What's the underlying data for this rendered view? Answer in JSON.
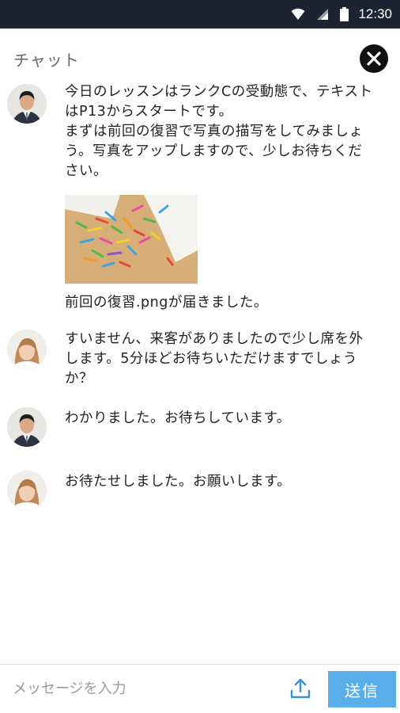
{
  "status_bar": {
    "time": "12:30",
    "icons": [
      "wifi-icon",
      "signal-icon",
      "battery-icon"
    ]
  },
  "header": {
    "title": "チャット",
    "close_icon": "close-icon"
  },
  "messages": [
    {
      "sender": "teacher",
      "avatar_icon": "avatar-male",
      "text": "今日のレッスンはランクCの受動態で、テキストはP13からスタートです。\nまずは前回の復習で写真の描写をしてみましょう。写真をアップしますので、少しお待ちください。",
      "attachment": {
        "kind": "image",
        "caption": "前回の復習.pngが届きました。"
      }
    },
    {
      "sender": "student",
      "avatar_icon": "avatar-female",
      "text": "すいません、来客がありましたので少し席を外します。5分ほどお待ちいただけますでしょうか？"
    },
    {
      "sender": "teacher",
      "avatar_icon": "avatar-male",
      "text": "わかりました。お待ちしています。"
    },
    {
      "sender": "student",
      "avatar_icon": "avatar-female",
      "text": "お待たせしました。お願いします。"
    }
  ],
  "composer": {
    "placeholder": "メッセージを入力",
    "value": "",
    "upload_icon": "upload-icon",
    "send_label": "送信"
  },
  "colors": {
    "status_bar_bg": "#1c2433",
    "send_button_bg": "#5aaee9",
    "upload_icon": "#3a8fd6",
    "close_button_bg": "#111111"
  }
}
